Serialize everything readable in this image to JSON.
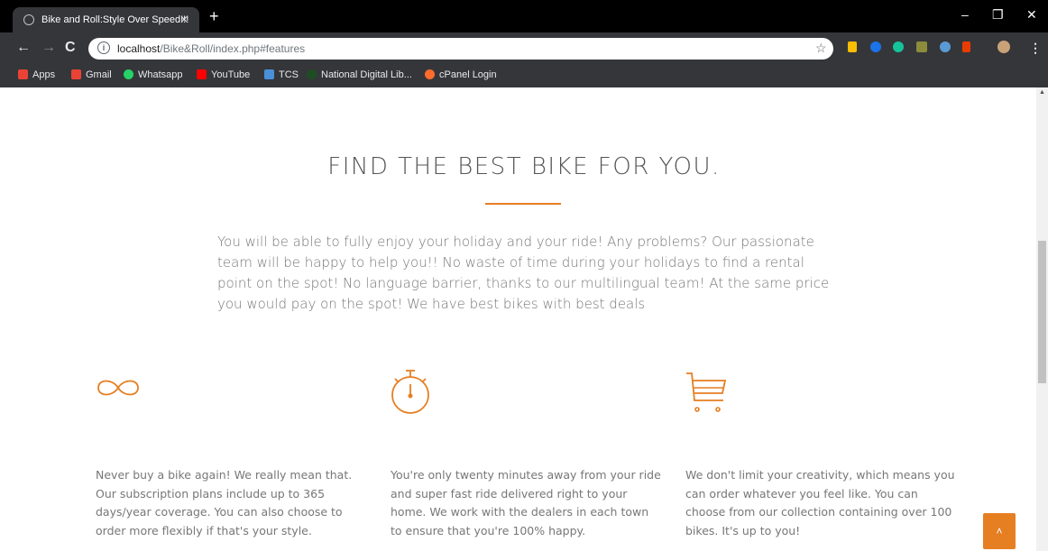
{
  "browser": {
    "tab_title": "Bike and Roll:Style Over Speed!!!",
    "tab_close": "×",
    "new_tab": "+",
    "url_host": "localhost",
    "url_path": "/Bike&Roll/index.php#features",
    "window_controls": [
      "–",
      "❐",
      "✕"
    ],
    "bookmarks": [
      {
        "label": "Apps",
        "icon": "apps-grid-icon",
        "color": "#ea4335"
      },
      {
        "label": "Gmail",
        "icon": "gmail-icon",
        "color": "#ea4335"
      },
      {
        "label": "Whatsapp",
        "icon": "whatsapp-icon",
        "color": "#25d366"
      },
      {
        "label": "YouTube",
        "icon": "youtube-icon",
        "color": "#ff0000"
      },
      {
        "label": "TCS",
        "icon": "tcs-icon",
        "color": "#4a90d9"
      },
      {
        "label": "National Digital Lib...",
        "icon": "ndl-icon",
        "color": "#1e7d32"
      },
      {
        "label": "cPanel Login",
        "icon": "cpanel-icon",
        "color": "#ff6c2c"
      }
    ]
  },
  "features_section": {
    "title": "FIND THE BEST BIKE FOR YOU.",
    "intro": "You will be able to fully enjoy your holiday and your ride! Any problems? Our passionate team will be happy to help you!! No waste of time during your holidays to find a rental point on the spot! No language barrier, thanks to our multilingual team! At the same price you would pay on the spot! We have best bikes with best deals",
    "accent_color": "#e67e22",
    "items": [
      {
        "icon": "infinity-icon",
        "text": "Never buy a bike again! We really mean that. Our subscription plans include up to 365 days/year coverage. You can also choose to order more flexibly if that's your style."
      },
      {
        "icon": "stopwatch-icon",
        "text": "You're only twenty minutes away from your ride and super fast ride delivered right to your home. We work with the dealers in each town to ensure that you're 100% happy."
      },
      {
        "icon": "cart-icon",
        "text": "We don't limit your creativity, which means you can order whatever you feel like. You can choose from our collection containing over 100 bikes. It's up to you!"
      }
    ]
  },
  "back_to_top": "˄"
}
